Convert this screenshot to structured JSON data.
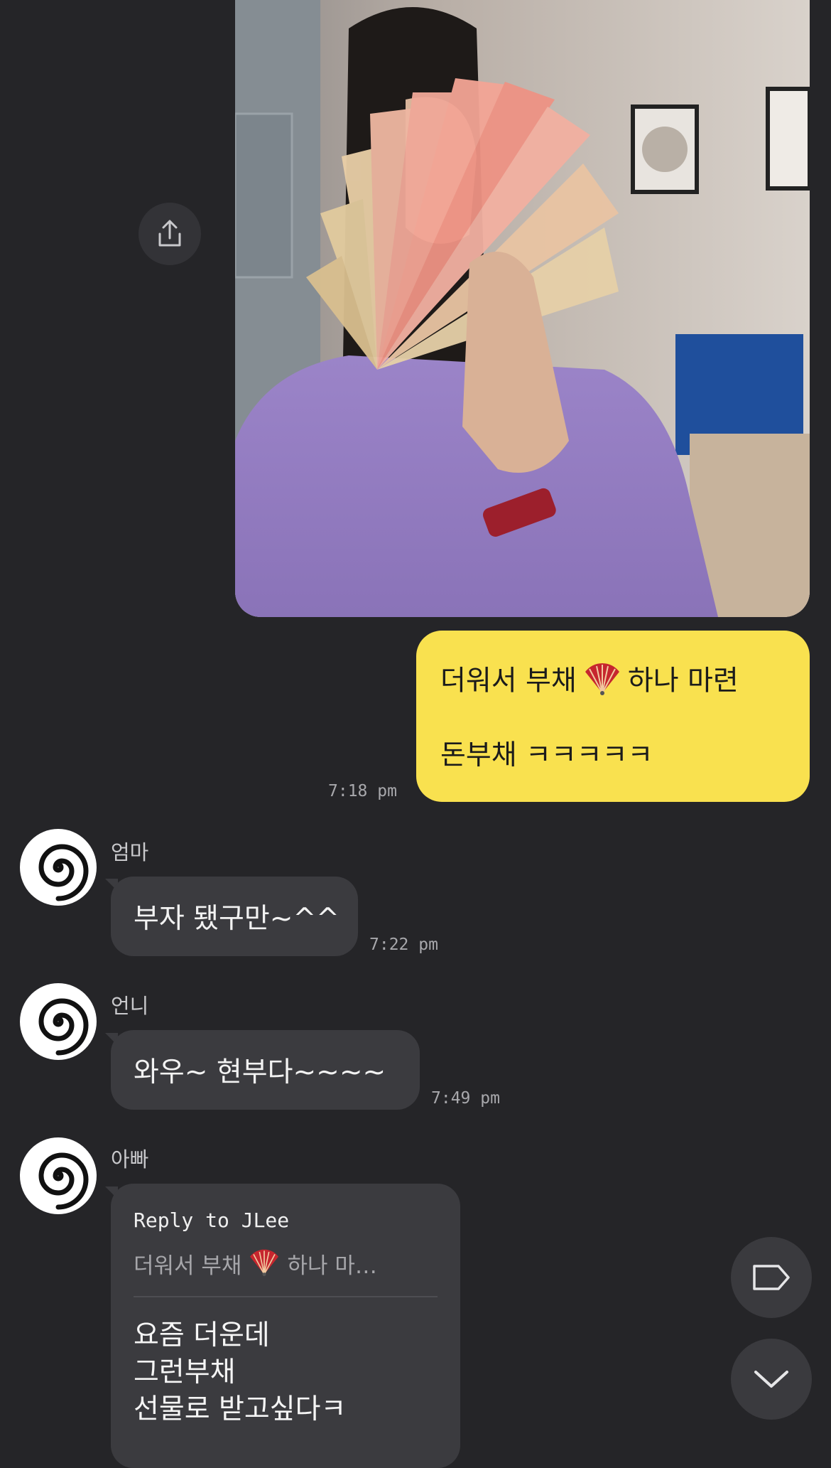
{
  "photo_message": {
    "share_icon": "share-icon"
  },
  "sent_message": {
    "line1_before": "더워서 부채",
    "line1_after": "하나 마련",
    "emoji": "folding-fan-emoji",
    "line2": "돈부채 ㅋㅋㅋㅋㅋ",
    "time": "7:18 pm"
  },
  "messages": [
    {
      "sender": "엄마",
      "text": "부자 됐구만~^^",
      "time": "7:22 pm"
    },
    {
      "sender": "언니",
      "text": "와우~ 현부다~~~~",
      "time": "7:49 pm"
    }
  ],
  "reply_message": {
    "sender": "아빠",
    "reply_to": "Reply to JLee",
    "quote_before": "더워서 부채",
    "quote_after": "하나 마…",
    "lines": [
      "요즘 더운데",
      "그런부채",
      "선물로 받고싶다ㅋ"
    ]
  },
  "floating_buttons": {
    "tag_icon": "tag-icon",
    "scroll_down_icon": "chevron-down-icon"
  },
  "colors": {
    "background": "#252528",
    "sent_bubble": "#f9e14f",
    "received_bubble": "#3b3b3f"
  }
}
